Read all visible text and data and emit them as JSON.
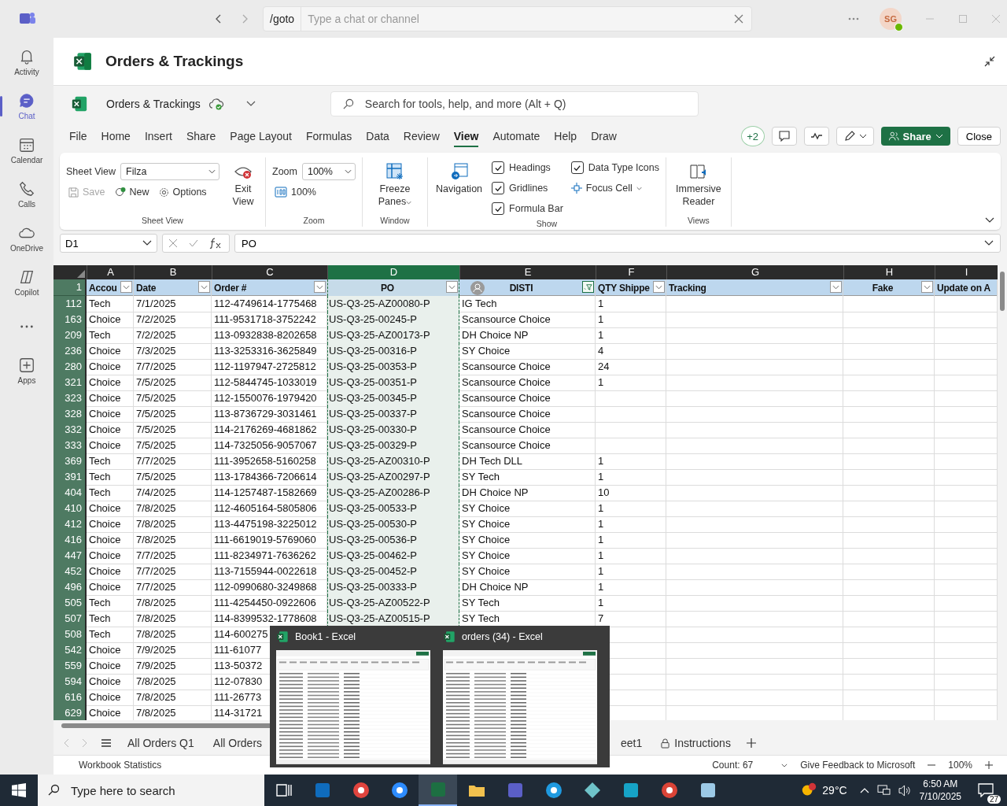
{
  "teams": {
    "command": "/goto",
    "search_placeholder": "Type a chat or channel",
    "avatar": "SG"
  },
  "rail": [
    {
      "label": "Activity",
      "selected": false
    },
    {
      "label": "Chat",
      "selected": true
    },
    {
      "label": "Calendar",
      "selected": false
    },
    {
      "label": "Calls",
      "selected": false
    },
    {
      "label": "OneDrive",
      "selected": false
    },
    {
      "label": "Copilot",
      "selected": false
    },
    {
      "kind": "more",
      "selected": false
    },
    {
      "label": "Apps",
      "selected": false
    }
  ],
  "app_title": "Orders & Trackings",
  "excel_header": {
    "file_name": "Orders & Trackings",
    "search_placeholder": "Search for tools, help, and more (Alt + Q)"
  },
  "menu_tabs": [
    {
      "label": "File",
      "selected": false
    },
    {
      "label": "Home",
      "selected": false
    },
    {
      "label": "Insert",
      "selected": false
    },
    {
      "label": "Share",
      "selected": false
    },
    {
      "label": "Page Layout",
      "selected": false
    },
    {
      "label": "Formulas",
      "selected": false
    },
    {
      "label": "Data",
      "selected": false
    },
    {
      "label": "Review",
      "selected": false
    },
    {
      "label": "View",
      "selected": true
    },
    {
      "label": "Automate",
      "selected": false
    },
    {
      "label": "Help",
      "selected": false
    },
    {
      "label": "Draw",
      "selected": false
    }
  ],
  "toolbar": {
    "coauthors": "+2",
    "share": "Share",
    "close": "Close"
  },
  "ribbon": {
    "sheet_view": {
      "label": "Sheet View",
      "view": "Filza",
      "save": {
        "label": "Save",
        "disabled": true
      },
      "new": "New",
      "options": "Options",
      "exit": "Exit View",
      "group": "Sheet View"
    },
    "zoom": {
      "label": "Zoom",
      "value": "100%",
      "reset": "100%",
      "group": "Zoom"
    },
    "window": {
      "freeze": "Freeze Panes",
      "group": "Window"
    },
    "show": {
      "navigation": "Navigation",
      "checkboxes": [
        {
          "label": "Headings",
          "checked": true
        },
        {
          "label": "Gridlines",
          "checked": true
        },
        {
          "label": "Formula Bar",
          "checked": true
        },
        {
          "label": "Data Type Icons",
          "checked": true
        }
      ],
      "focus_cell": "Focus Cell",
      "group": "Show"
    },
    "views": {
      "reader": "Immersive Reader",
      "group": "Views"
    }
  },
  "formula_bar": {
    "cell": "D1",
    "formula": "PO"
  },
  "header_row_number": "1",
  "columns": [
    {
      "letter": "A",
      "header": "Accou",
      "selected": false,
      "filtered": false
    },
    {
      "letter": "B",
      "header": "Date",
      "selected": false,
      "filtered": false
    },
    {
      "letter": "C",
      "header": "Order #",
      "selected": false,
      "filtered": false
    },
    {
      "letter": "D",
      "header": "PO",
      "selected": true,
      "filtered": false
    },
    {
      "letter": "E",
      "header": "DISTI",
      "selected": false,
      "filtered": true
    },
    {
      "letter": "F",
      "header": "QTY Shippe",
      "selected": false,
      "filtered": false
    },
    {
      "letter": "G",
      "header": "Tracking",
      "selected": false,
      "filtered": false
    },
    {
      "letter": "H",
      "header": "Fake",
      "selected": false,
      "filtered": false
    },
    {
      "letter": "I",
      "header": "Update on A",
      "selected": false
    }
  ],
  "rows": [
    {
      "number": "112",
      "cells": [
        "Tech",
        "7/1/2025",
        "112-4749614-1775468",
        "US-Q3-25-AZ00080-P",
        "IG Tech",
        "1"
      ]
    },
    {
      "number": "163",
      "cells": [
        "Choice",
        "7/2/2025",
        "111-9531718-3752242",
        "US-Q3-25-00245-P",
        "Scansource Choice",
        "1"
      ]
    },
    {
      "number": "209",
      "cells": [
        "Tech",
        "7/2/2025",
        "113-0932838-8202658",
        "US-Q3-25-AZ00173-P",
        "DH Choice NP",
        "1"
      ]
    },
    {
      "number": "236",
      "cells": [
        "Choice",
        "7/3/2025",
        "113-3253316-3625849",
        "US-Q3-25-00316-P",
        "SY Choice",
        "4"
      ]
    },
    {
      "number": "280",
      "cells": [
        "Choice",
        "7/7/2025",
        "112-1197947-2725812",
        "US-Q3-25-00353-P",
        "Scansource Choice",
        "24"
      ]
    },
    {
      "number": "321",
      "cells": [
        "Choice",
        "7/5/2025",
        "112-5844745-1033019",
        "US-Q3-25-00351-P",
        "Scansource Choice",
        "1"
      ]
    },
    {
      "number": "323",
      "cells": [
        "Choice",
        "7/5/2025",
        "112-1550076-1979420",
        "US-Q3-25-00345-P",
        "Scansource Choice"
      ]
    },
    {
      "number": "328",
      "cells": [
        "Choice",
        "7/5/2025",
        "113-8736729-3031461",
        "US-Q3-25-00337-P",
        "Scansource Choice"
      ]
    },
    {
      "number": "332",
      "cells": [
        "Choice",
        "7/5/2025",
        "114-2176269-4681862",
        "US-Q3-25-00330-P",
        "Scansource Choice"
      ]
    },
    {
      "number": "333",
      "cells": [
        "Choice",
        "7/5/2025",
        "114-7325056-9057067",
        "US-Q3-25-00329-P",
        "Scansource Choice"
      ]
    },
    {
      "number": "369",
      "cells": [
        "Tech",
        "7/7/2025",
        "111-3952658-5160258",
        "US-Q3-25-AZ00310-P",
        "DH Tech DLL",
        "1"
      ]
    },
    {
      "number": "391",
      "cells": [
        "Tech",
        "7/5/2025",
        "113-1784366-7206614",
        "US-Q3-25-AZ00297-P",
        "SY Tech",
        "1"
      ]
    },
    {
      "number": "404",
      "cells": [
        "Tech",
        "7/4/2025",
        "114-1257487-1582669",
        "US-Q3-25-AZ00286-P",
        "DH Choice NP",
        "10"
      ]
    },
    {
      "number": "410",
      "cells": [
        "Choice",
        "7/8/2025",
        "112-4605164-5805806",
        "US-Q3-25-00533-P",
        "SY Choice",
        "1"
      ]
    },
    {
      "number": "412",
      "cells": [
        "Choice",
        "7/8/2025",
        "113-4475198-3225012",
        "US-Q3-25-00530-P",
        "SY Choice",
        "1"
      ]
    },
    {
      "number": "416",
      "cells": [
        "Choice",
        "7/8/2025",
        "111-6619019-5769060",
        "US-Q3-25-00536-P",
        "SY Choice",
        "1"
      ]
    },
    {
      "number": "447",
      "cells": [
        "Choice",
        "7/7/2025",
        "111-8234971-7636262",
        "US-Q3-25-00462-P",
        "SY Choice",
        "1"
      ]
    },
    {
      "number": "452",
      "cells": [
        "Choice",
        "7/7/2025",
        "113-7155944-0022618",
        "US-Q3-25-00452-P",
        "SY Choice",
        "1"
      ]
    },
    {
      "number": "496",
      "cells": [
        "Choice",
        "7/7/2025",
        "112-0990680-3249868",
        "US-Q3-25-00333-P",
        "DH Choice NP",
        "1"
      ]
    },
    {
      "number": "505",
      "cells": [
        "Tech",
        "7/8/2025",
        "111-4254450-0922606",
        "US-Q3-25-AZ00522-P",
        "SY Tech",
        "1"
      ]
    },
    {
      "number": "507",
      "cells": [
        "Tech",
        "7/8/2025",
        "114-8399532-1778608",
        "US-Q3-25-AZ00515-P",
        "SY Tech",
        "7"
      ]
    },
    {
      "number": "508",
      "cells": [
        "Tech",
        "7/8/2025",
        "114-600275"
      ]
    },
    {
      "number": "542",
      "cells": [
        "Choice",
        "7/9/2025",
        "111-61077"
      ]
    },
    {
      "number": "559",
      "cells": [
        "Choice",
        "7/9/2025",
        "113-50372"
      ]
    },
    {
      "number": "594",
      "cells": [
        "Choice",
        "7/8/2025",
        "112-07830"
      ]
    },
    {
      "number": "616",
      "cells": [
        "Choice",
        "7/8/2025",
        "111-26773"
      ]
    },
    {
      "number": "629",
      "cells": [
        "Choice",
        "7/8/2025",
        "114-31721"
      ]
    }
  ],
  "sheet_tabs": [
    {
      "label": "All Orders Q1",
      "locked": false
    },
    {
      "label": "All Orders",
      "locked": false
    },
    {
      "label": "eet1",
      "locked": false
    },
    {
      "label": "Instructions",
      "locked": true
    }
  ],
  "status_bar": {
    "left": "Workbook Statistics",
    "count": "Count: 67",
    "feedback": "Give Feedback to Microsoft",
    "zoom": "100%"
  },
  "taskbar": {
    "search_placeholder": "Type here to search",
    "apps": [
      {
        "active": false
      },
      {
        "active": false
      },
      {
        "active": false
      },
      {
        "active": false
      },
      {
        "active": true
      },
      {
        "active": false
      },
      {
        "active": false
      },
      {
        "active": false
      },
      {
        "active": false
      },
      {
        "active": false
      },
      {
        "active": false
      },
      {
        "active": false
      }
    ],
    "temperature": "29°C",
    "time": "6:50 AM",
    "date": "7/10/2025",
    "notifications": "27"
  },
  "task_previews": [
    {
      "title": "Book1 - Excel"
    },
    {
      "title": "orders (34) - Excel"
    }
  ]
}
